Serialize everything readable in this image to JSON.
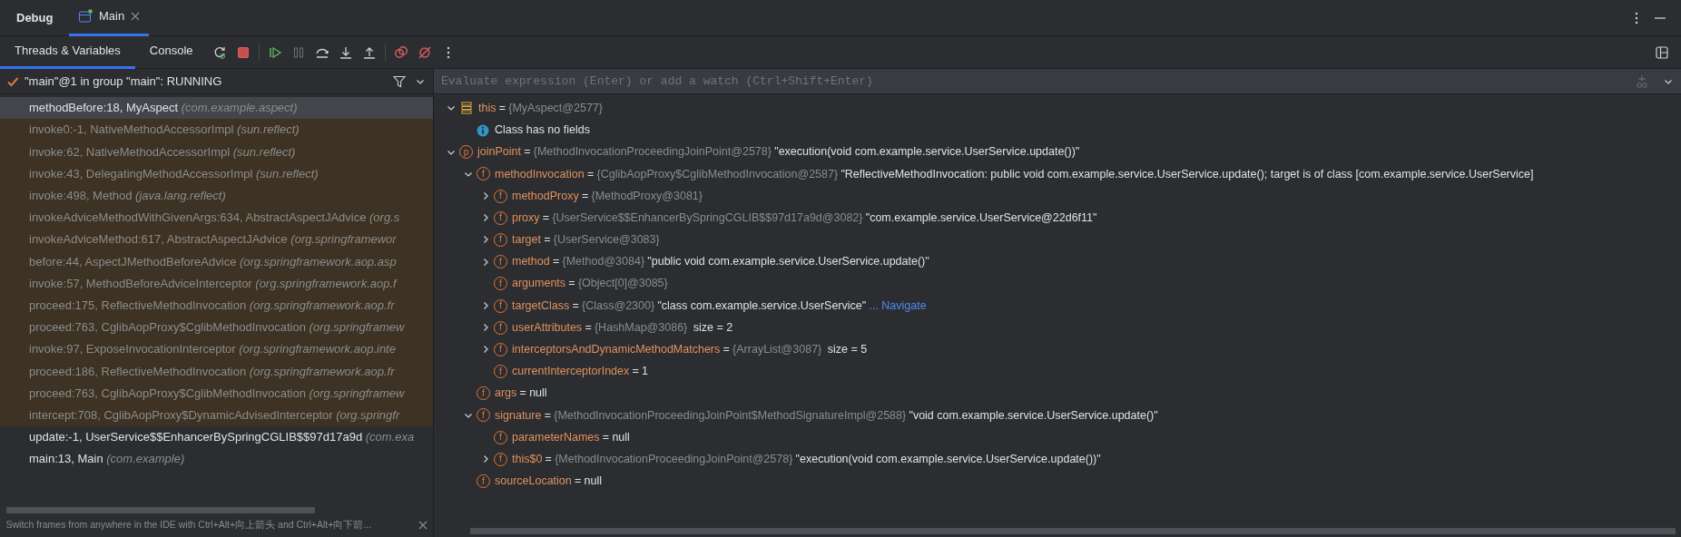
{
  "header": {
    "title": "Debug",
    "tabs": [
      {
        "label": "Main",
        "selected": true
      }
    ]
  },
  "subtabs": [
    {
      "label": "Threads & Variables",
      "selected": true
    },
    {
      "label": "Console",
      "selected": false
    }
  ],
  "thread": {
    "label": "\"main\"@1 in group \"main\": RUNNING"
  },
  "frames": [
    {
      "text": "methodBefore:18, MyAspect",
      "package": "(com.example.aspect)",
      "selected": true,
      "library": false
    },
    {
      "text": "invoke0:-1, NativeMethodAccessorImpl",
      "package": "(sun.reflect)",
      "selected": false,
      "library": true
    },
    {
      "text": "invoke:62, NativeMethodAccessorImpl",
      "package": "(sun.reflect)",
      "selected": false,
      "library": true
    },
    {
      "text": "invoke:43, DelegatingMethodAccessorImpl",
      "package": "(sun.reflect)",
      "selected": false,
      "library": true
    },
    {
      "text": "invoke:498, Method",
      "package": "(java.lang.reflect)",
      "selected": false,
      "library": true
    },
    {
      "text": "invokeAdviceMethodWithGivenArgs:634, AbstractAspectJAdvice",
      "package": "(org.s",
      "selected": false,
      "library": true
    },
    {
      "text": "invokeAdviceMethod:617, AbstractAspectJAdvice",
      "package": "(org.springframewor",
      "selected": false,
      "library": true
    },
    {
      "text": "before:44, AspectJMethodBeforeAdvice",
      "package": "(org.springframework.aop.asp",
      "selected": false,
      "library": true
    },
    {
      "text": "invoke:57, MethodBeforeAdviceInterceptor",
      "package": "(org.springframework.aop.f",
      "selected": false,
      "library": true
    },
    {
      "text": "proceed:175, ReflectiveMethodInvocation",
      "package": "(org.springframework.aop.fr",
      "selected": false,
      "library": true
    },
    {
      "text": "proceed:763, CglibAopProxy$CglibMethodInvocation",
      "package": "(org.springframew",
      "selected": false,
      "library": true
    },
    {
      "text": "invoke:97, ExposeInvocationInterceptor",
      "package": "(org.springframework.aop.inte",
      "selected": false,
      "library": true
    },
    {
      "text": "proceed:186, ReflectiveMethodInvocation",
      "package": "(org.springframework.aop.fr",
      "selected": false,
      "library": true
    },
    {
      "text": "proceed:763, CglibAopProxy$CglibMethodInvocation",
      "package": "(org.springframew",
      "selected": false,
      "library": true
    },
    {
      "text": "intercept:708, CglibAopProxy$DynamicAdvisedInterceptor",
      "package": "(org.springfr",
      "selected": false,
      "library": true
    },
    {
      "text": "update:-1, UserService$$EnhancerBySpringCGLIB$$97d17a9d",
      "package": "(com.exa",
      "selected": false,
      "library": false
    },
    {
      "text": "main:13, Main",
      "package": "(com.example)",
      "selected": false,
      "library": false
    }
  ],
  "hint": {
    "text": "Switch frames from anywhere in the IDE with Ctrl+Alt+向上箭头 and Ctrl+Alt+向下箭..."
  },
  "evaluate": {
    "placeholder": "Evaluate expression (Enter) or add a watch (Ctrl+Shift+Enter)"
  },
  "variables": [
    {
      "kind": "object",
      "name": "this",
      "op": "=",
      "type_ref": "{MyAspect@2577}",
      "expanded": true,
      "children": [
        {
          "kind": "info",
          "text": "Class has no fields"
        }
      ]
    },
    {
      "kind": "param",
      "badge": "p",
      "name": "joinPoint",
      "op": "=",
      "type_ref": "{MethodInvocationProceedingJoinPoint@2578}",
      "value": "\"execution(void com.example.service.UserService.update())\"",
      "expanded": true,
      "children": [
        {
          "kind": "field",
          "badge": "f",
          "name": "methodInvocation",
          "op": "=",
          "type_ref": "{CglibAopProxy$CglibMethodInvocation@2587}",
          "value": "\"ReflectiveMethodInvocation: public void com.example.service.UserService.update(); target is of class [com.example.service.UserService]",
          "expanded": true,
          "children": [
            {
              "kind": "field",
              "badge": "f",
              "name": "methodProxy",
              "op": "=",
              "type_ref": "{MethodProxy@3081}",
              "expanded": false
            },
            {
              "kind": "field",
              "badge": "f",
              "name": "proxy",
              "op": "=",
              "type_ref": "{UserService$$EnhancerBySpringCGLIB$$97d17a9d@3082}",
              "value": "\"com.example.service.UserService@22d6f11\"",
              "expanded": false
            },
            {
              "kind": "field",
              "badge": "f",
              "name": "target",
              "op": "=",
              "type_ref": "{UserService@3083}",
              "expanded": false
            },
            {
              "kind": "field",
              "badge": "f",
              "name": "method",
              "op": "=",
              "type_ref": "{Method@3084}",
              "value": "\"public void com.example.service.UserService.update()\"",
              "expanded": false
            },
            {
              "kind": "field",
              "badge": "f",
              "name": "arguments",
              "op": "=",
              "type_ref": "{Object[0]@3085}"
            },
            {
              "kind": "field",
              "badge": "f",
              "name": "targetClass",
              "op": "=",
              "type_ref": "{Class@2300}",
              "value": "\"class com.example.service.UserService\"",
              "link": "... Navigate",
              "expanded": false
            },
            {
              "kind": "field",
              "badge": "f",
              "name": "userAttributes",
              "op": "=",
              "type_ref": "{HashMap@3086}",
              "value": "size = 2",
              "expanded": false
            },
            {
              "kind": "field",
              "badge": "f",
              "name": "interceptorsAndDynamicMethodMatchers",
              "op": "=",
              "type_ref": "{ArrayList@3087}",
              "value": "size = 5",
              "expanded": false
            },
            {
              "kind": "field",
              "badge": "f",
              "name": "currentInterceptorIndex",
              "op": "=",
              "value": "1"
            }
          ]
        },
        {
          "kind": "field",
          "badge": "f",
          "name": "args",
          "op": "=",
          "value": "null"
        },
        {
          "kind": "field",
          "badge": "f",
          "name": "signature",
          "op": "=",
          "type_ref": "{MethodInvocationProceedingJoinPoint$MethodSignatureImpl@2588}",
          "value": "\"void com.example.service.UserService.update()\"",
          "expanded": true,
          "children": [
            {
              "kind": "field",
              "badge": "f",
              "name": "parameterNames",
              "op": "=",
              "value": "null"
            },
            {
              "kind": "field",
              "badge": "f",
              "name": "this$0",
              "op": "=",
              "type_ref": "{MethodInvocationProceedingJoinPoint@2578}",
              "value": "\"execution(void com.example.service.UserService.update())\"",
              "expanded": false
            }
          ]
        },
        {
          "kind": "field",
          "badge": "f",
          "name": "sourceLocation",
          "op": "=",
          "value": "null"
        }
      ]
    }
  ]
}
